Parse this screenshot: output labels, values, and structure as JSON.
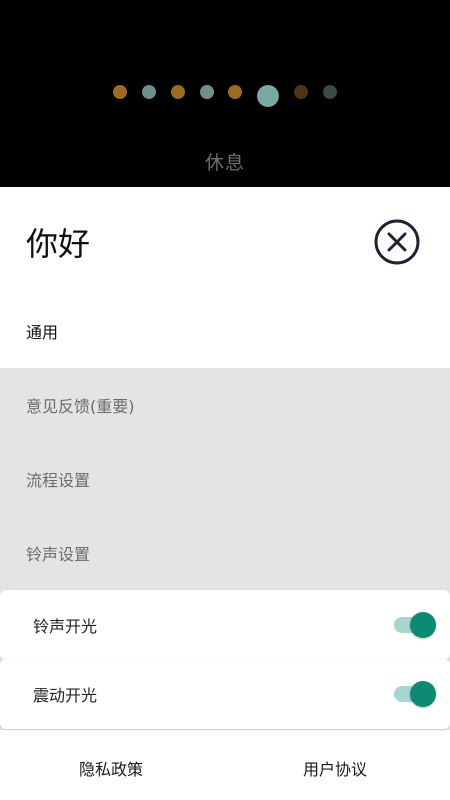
{
  "header": {
    "status_label": "休息",
    "dots": [
      {
        "color": "#9b6b1e",
        "size": "small"
      },
      {
        "color": "#6f8f8c",
        "size": "small"
      },
      {
        "color": "#9b6b1e",
        "size": "small"
      },
      {
        "color": "#6f8f8c",
        "size": "small"
      },
      {
        "color": "#9b6b1e",
        "size": "small"
      },
      {
        "color": "#7aa8a4",
        "size": "large"
      },
      {
        "color": "#4d3514",
        "size": "small"
      },
      {
        "color": "#3a4a49",
        "size": "small"
      }
    ]
  },
  "sheet": {
    "greeting": "你好",
    "close_icon": "close-circle-icon",
    "menu": [
      {
        "label": "通用",
        "active": true
      },
      {
        "label": "意见反馈(重要)",
        "active": false
      },
      {
        "label": "流程设置",
        "active": false
      },
      {
        "label": "铃声设置",
        "active": false
      }
    ],
    "toggles": [
      {
        "label": "铃声开光",
        "on": true
      },
      {
        "label": "震动开光",
        "on": true
      }
    ],
    "accent_color": "#0d8a73"
  },
  "footer": {
    "privacy": "隐私政策",
    "agreement": "用户协议"
  }
}
